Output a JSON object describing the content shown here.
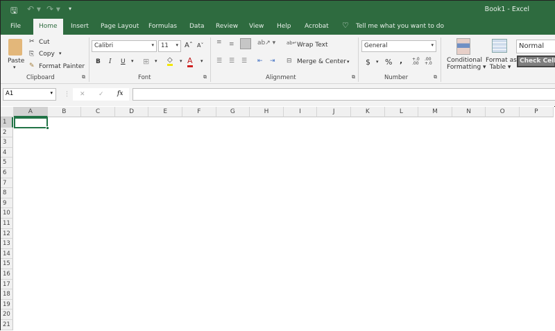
{
  "title_bar": {
    "title": "Book1  -  Excel",
    "qat": [
      "save-icon",
      "undo-icon",
      "redo-icon",
      "customize-icon"
    ]
  },
  "tabs": [
    "File",
    "Home",
    "Insert",
    "Page Layout",
    "Formulas",
    "Data",
    "Review",
    "View",
    "Help",
    "Acrobat"
  ],
  "active_tab": "Home",
  "tell_me": "Tell me what you want to do",
  "clipboard": {
    "paste": "Paste",
    "cut": "Cut",
    "copy": "Copy",
    "format_painter": "Format Painter",
    "label": "Clipboard"
  },
  "font": {
    "name": "Calibri",
    "size": "11",
    "bold": "B",
    "italic": "I",
    "underline": "U",
    "label": "Font"
  },
  "alignment": {
    "wrap_text": "Wrap Text",
    "merge_center": "Merge & Center",
    "label": "Alignment"
  },
  "number": {
    "format": "General",
    "currency": "$",
    "percent": "%",
    "comma": ",",
    "inc_decimal": "+.0 .00",
    "dec_decimal": ".00 +.0",
    "label": "Number"
  },
  "styles": {
    "conditional_formatting": [
      "Conditional",
      "Formatting"
    ],
    "format_as_table": [
      "Format as",
      "Table"
    ],
    "normal": "Normal",
    "check_cell": "Check Cell"
  },
  "formula_bar": {
    "name_box": "A1",
    "cancel": "✕",
    "enter": "✓",
    "fx": "fx",
    "value": ""
  },
  "columns": [
    "A",
    "B",
    "C",
    "D",
    "E",
    "F",
    "G",
    "H",
    "I",
    "J",
    "K",
    "L",
    "M",
    "N",
    "O",
    "P"
  ],
  "rows": [
    "1",
    "2",
    "3",
    "4",
    "5",
    "6",
    "7",
    "8",
    "9",
    "10",
    "11",
    "12",
    "13",
    "14",
    "15",
    "16",
    "17",
    "18",
    "19",
    "20",
    "21"
  ],
  "selected_cell": "A1",
  "colors": {
    "brand": "#2e6b3f",
    "ribbon": "#f3f3f3",
    "selection": "#217346"
  }
}
